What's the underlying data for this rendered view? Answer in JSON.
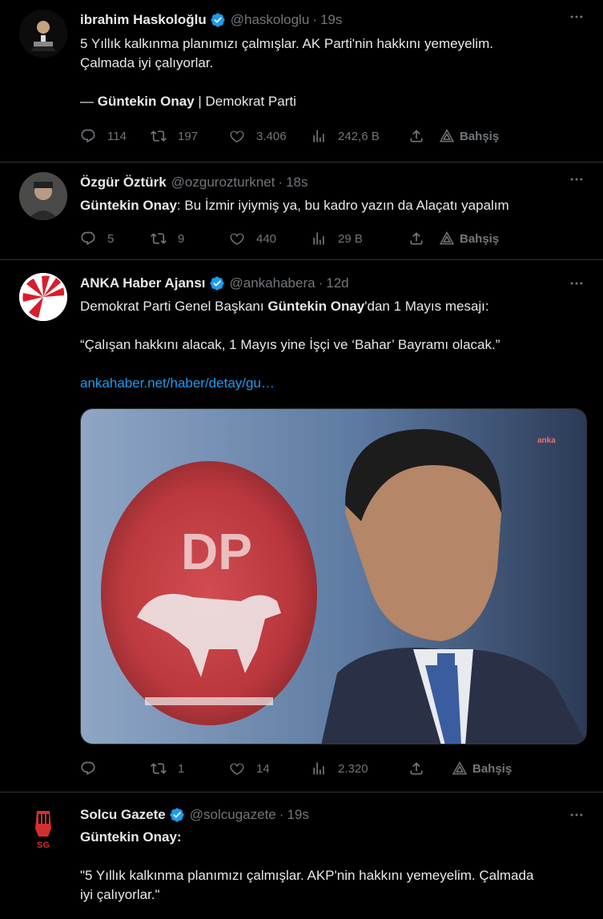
{
  "tweets": [
    {
      "name": "ibrahim Haskoloğlu",
      "handle": "@haskologlu",
      "dot": "·",
      "time": "19s",
      "line1": "5 Yıllık kalkınma planımızı çalmışlar. AK Parti'nin hakkını yemeyelim.",
      "line2": "Çalmada iyi çalıyorlar.",
      "dash": "— ",
      "sig_name": "Güntekin Onay",
      "sig_rest": " | Demokrat Parti",
      "replies": "114",
      "retweets": "197",
      "likes": "3.406",
      "views": "242,6 B",
      "tip": "Bahşiş"
    },
    {
      "name": "Özgür Öztürk",
      "handle": "@ozgurozturknet",
      "dot": "·",
      "time": "18s",
      "bold": "Güntekin Onay",
      "rest": ": Bu İzmir iyiymiş ya, bu kadro yazın da Alaçatı yapalım",
      "replies": "5",
      "retweets": "9",
      "likes": "440",
      "views": "29 B",
      "tip": "Bahşiş"
    },
    {
      "name": "ANKA Haber Ajansı",
      "handle": "@ankahabera",
      "dot": "·",
      "time": "12d",
      "p1a": "Demokrat Parti Genel Başkanı ",
      "p1b": "Güntekin Onay",
      "p1c": "'dan 1 Mayıs mesajı:",
      "p2": "“Çalışan hakkını alacak, 1 Mayıs yine İşçi ve ‘Bahar’ Bayramı olacak.”",
      "link": "ankahaber.net/haber/detay/gu…",
      "watermark": "anka",
      "logo_text": "DP",
      "replies": "",
      "retweets": "1",
      "likes": "14",
      "views": "2.320",
      "tip": "Bahşiş"
    },
    {
      "name": "Solcu Gazete",
      "handle": "@solcugazete",
      "dot": "·",
      "time": "19s",
      "bold": "Güntekin Onay",
      "colon": ":",
      "quote1": "\"5 Yıllık kalkınma planımızı çalmışlar. AKP'nin hakkını yemeyelim. Çalmada",
      "quote2": "iyi çalıyorlar.\"",
      "logo_text": "SG"
    }
  ],
  "colors": {
    "accent": "#1d9bf0",
    "muted": "#71767b",
    "text": "#e7e9ea",
    "divider": "#2f3336"
  }
}
